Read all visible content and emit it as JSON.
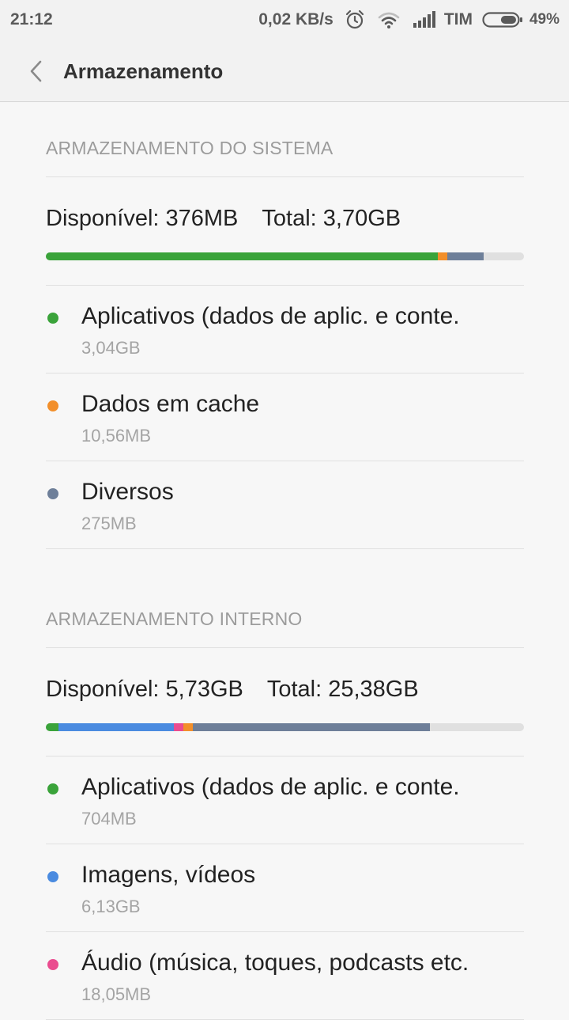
{
  "status_bar": {
    "time": "21:12",
    "speed": "0,02 KB/s",
    "carrier": "TIM",
    "battery": "49%",
    "battery_level": 0.49
  },
  "app_bar": {
    "back_icon": "chevron-left-icon",
    "title": "Armazenamento"
  },
  "colors": {
    "apps": "#3aa33a",
    "cache": "#f28f2b",
    "misc": "#6e7f99",
    "images": "#4a8be0",
    "audio": "#ea4c8f",
    "free": "#e0e0e0"
  },
  "system": {
    "header": "ARMAZENAMENTO DO SISTEMA",
    "available": "Disponível: 376MB",
    "total": "Total: 3,70GB",
    "bar_fractions": {
      "apps": 0.82,
      "cache": 0.02,
      "misc": 0.075
    },
    "items": [
      {
        "label": "Aplicativos (dados de aplic. e conte.",
        "size": "3,04GB",
        "color": "#3aa33a"
      },
      {
        "label": "Dados em cache",
        "size": "10,56MB",
        "color": "#f28f2b"
      },
      {
        "label": "Diversos",
        "size": "275MB",
        "color": "#6e7f99"
      }
    ]
  },
  "internal": {
    "header": "ARMAZENAMENTO INTERNO",
    "available": "Disponível: 5,73GB",
    "total": "Total: 25,38GB",
    "bar_fractions": {
      "apps": 0.027,
      "images": 0.241,
      "audio": 0.02,
      "cache": 0.02,
      "misc": 0.495
    },
    "items": [
      {
        "label": "Aplicativos (dados de aplic. e conte.",
        "size": "704MB",
        "color": "#3aa33a"
      },
      {
        "label": "Imagens, vídeos",
        "size": "6,13GB",
        "color": "#4a8be0"
      },
      {
        "label": "Áudio (música, toques, podcasts etc.",
        "size": "18,05MB",
        "color": "#ea4c8f"
      }
    ]
  }
}
